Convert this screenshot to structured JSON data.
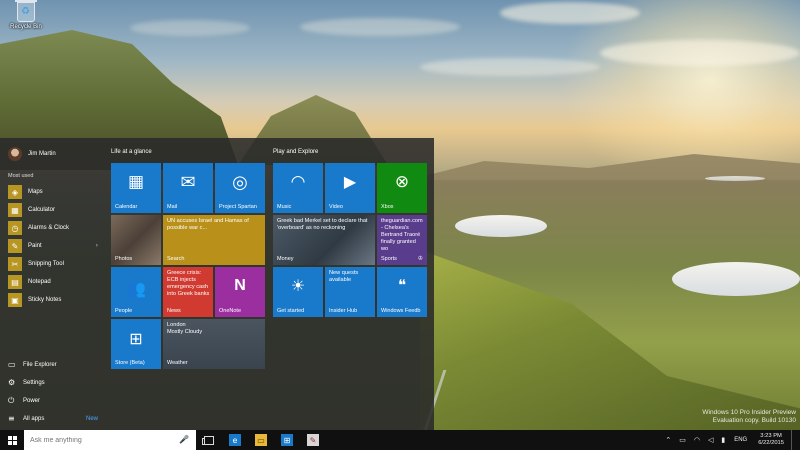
{
  "desktop": {
    "recycle_bin_label": "Recycle Bin",
    "watermark": {
      "line1": "Windows 10 Pro Insider Preview",
      "line2": "Evaluation copy. Build 10130"
    }
  },
  "start_menu": {
    "user": {
      "name": "Jim Martin"
    },
    "most_used_label": "Most used",
    "apps": [
      {
        "label": "Maps",
        "icon": "map-icon"
      },
      {
        "label": "Calculator",
        "icon": "calculator-icon"
      },
      {
        "label": "Alarms & Clock",
        "icon": "alarm-clock-icon"
      },
      {
        "label": "Paint",
        "icon": "paint-icon",
        "has_submenu": true
      },
      {
        "label": "Snipping Tool",
        "icon": "scissors-icon"
      },
      {
        "label": "Notepad",
        "icon": "notepad-icon"
      },
      {
        "label": "Sticky Notes",
        "icon": "sticky-note-icon"
      }
    ],
    "bottom": [
      {
        "label": "File Explorer",
        "icon": "folder-icon"
      },
      {
        "label": "Settings",
        "icon": "gear-icon"
      },
      {
        "label": "Power",
        "icon": "power-icon"
      },
      {
        "label": "All apps",
        "icon": "list-icon",
        "badge": "New"
      }
    ],
    "groups": [
      {
        "title": "Life at a glance"
      },
      {
        "title": "Play and Explore"
      }
    ],
    "tiles": {
      "calendar": {
        "label": "Calendar"
      },
      "mail": {
        "label": "Mail"
      },
      "spartan": {
        "label": "Project Spartan"
      },
      "photos": {
        "label": "Photos"
      },
      "search": {
        "label": "Search",
        "text": "UN accuses Israel and Hamas of possible war c..."
      },
      "news": {
        "label": "News",
        "text": "Greece crisis: ECB injects emergency cash into Greek banks"
      },
      "onenote": {
        "label": "OneNote"
      },
      "people": {
        "label": "People"
      },
      "store": {
        "label": "Store (Beta)"
      },
      "weather": {
        "label": "Weather",
        "line1": "London",
        "line2": "Mostly Cloudy"
      },
      "music": {
        "label": "Music"
      },
      "video": {
        "label": "Video"
      },
      "xbox": {
        "label": "Xbox"
      },
      "money": {
        "label": "Money",
        "text": "Greek bad Merkel set to declare that 'overboard' as no reckoning"
      },
      "sports": {
        "label": "Sports",
        "text": "theguardian.com - Chelsea's Bertrand Traoré finally granted wo"
      },
      "get_started": {
        "label": "Get started"
      },
      "insider_hub": {
        "label": "Insider Hub",
        "text": "New quests available"
      },
      "feedback": {
        "label": "Windows Feedb"
      }
    },
    "colors": {
      "tile_blue": "#1979ca",
      "tile_gold": "#b8901a",
      "tile_red": "#d13a30",
      "tile_purple": "#9c2fa0",
      "tile_green": "#108a10",
      "app_icon_gold": "#b89624"
    }
  },
  "taskbar": {
    "search_placeholder": "Ask me anything",
    "pinned": [
      "task-view-icon",
      "edge-icon",
      "file-explorer-icon",
      "store-icon",
      "paint-icon"
    ],
    "language": "ENG",
    "time": "3:23 PM",
    "date": "6/22/2015"
  }
}
